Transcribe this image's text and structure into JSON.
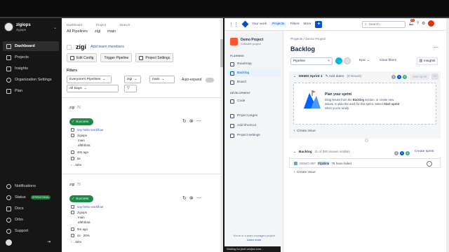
{
  "circleci": {
    "org_name": "zigiops",
    "org_sub": "zigiops",
    "nav": [
      {
        "label": "Dashboard"
      },
      {
        "label": "Projects"
      },
      {
        "label": "Insights"
      },
      {
        "label": "Organization Settings"
      },
      {
        "label": "Plan"
      }
    ],
    "bottom_nav": [
      {
        "label": "Notifications"
      },
      {
        "label": "Status",
        "badge": "OPERATIONAL"
      },
      {
        "label": "Docs"
      },
      {
        "label": "Orbs"
      },
      {
        "label": "Support"
      }
    ],
    "breadcrumb_labels": [
      "Dashboard",
      "Project",
      "Branch"
    ],
    "breadcrumb_values": [
      "All Pipelines",
      "zigi",
      "main"
    ],
    "project_title": "zigi",
    "add_team_members": "Add team members",
    "buttons": [
      "Edit Config",
      "Trigger Pipeline",
      "Project Settings"
    ],
    "filters_label": "Filters",
    "filter_pipelines": "Everyone's Pipelines",
    "filter_project": "zigi",
    "filter_branch": "main",
    "filter_dates": "All Days",
    "auto_expand": "Auto-expand",
    "runs": [
      {
        "project": "zigi",
        "number": "76",
        "status": "Success",
        "workflow": "say-hello-workflow",
        "user": "zigiops",
        "branch": "main",
        "commit": "af6f4b4a",
        "age": "40s ago",
        "duration": "5s",
        "jobs": "Jobs"
      },
      {
        "project": "zigi",
        "number": "75",
        "status": "Success",
        "workflow": "say-hello-workflow",
        "user": "zigiops",
        "branch": "main",
        "commit": "af6f4b4a",
        "age": "9m ago",
        "duration": "4s",
        "delta": "20%",
        "jobs": "Jobs"
      }
    ]
  },
  "jira": {
    "top_nav": [
      "Your work",
      "Projects",
      "Filters",
      "More"
    ],
    "search_placeholder": "Search",
    "notification_count": "9+",
    "project_name": "Demo Project",
    "project_type": "Software project",
    "planning_label": "PLANNING",
    "planning_items": [
      "Roadmap",
      "Backlog",
      "Board"
    ],
    "development_label": "DEVELOPMENT",
    "development_items": [
      "Code"
    ],
    "other_items": [
      "Project pages",
      "Add shortcut",
      "Project settings"
    ],
    "sidebar_footer": "You're in a team-managed project",
    "learn_more": "Learn more",
    "breadcrumb": "Projects  /  Demo Project",
    "title": "Backlog",
    "filter_value": "Pipeline",
    "epic_label": "Epic",
    "clear_filters": "Clear filters",
    "insights": "Insights",
    "sprint_name": "DEMO Sprint 1",
    "add_dates": "Add dates",
    "sprint_count": "(0 issues)",
    "sprint_pills": [
      "0",
      "0",
      "0"
    ],
    "start_sprint": "Start sprint",
    "plan_title": "Plan your sprint",
    "plan_text_1": "Drag issues from the ",
    "plan_text_bold_1": "Backlog",
    "plan_text_2": " section, or create new issues, to plan the work for this sprint. Select ",
    "plan_text_bold_2": "Start sprint",
    "plan_text_3": " when you're ready.",
    "create_issue": "Create issue",
    "backlog_name": "Backlog",
    "backlog_count": "(1 of 380 issues visible)",
    "backlog_pills": [
      "0",
      "0",
      "0"
    ],
    "create_sprint": "Create sprint",
    "issue_key": "DEMO-387",
    "issue_highlight": "Pipeline",
    "issue_rest": "76 have failed",
    "status_bar": "Waiting for jira0.zenjira.com..."
  }
}
